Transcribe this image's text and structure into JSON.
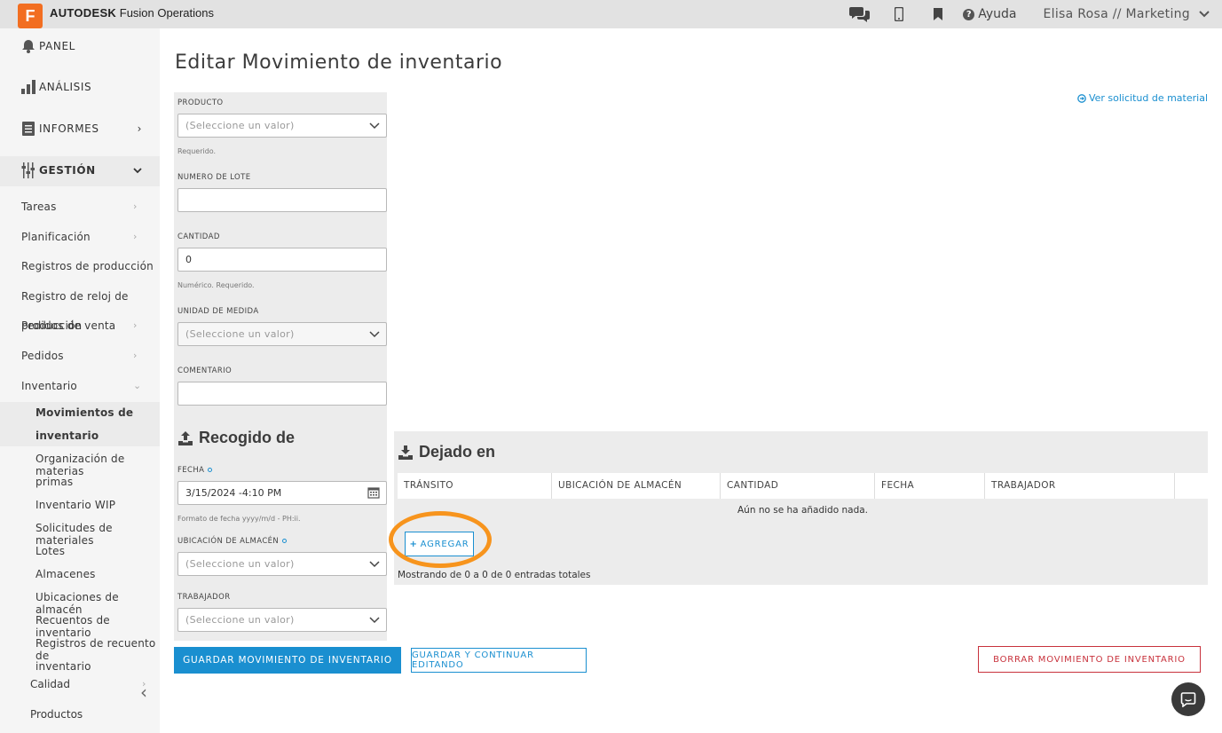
{
  "app": {
    "logo_letter": "F",
    "brand_strong": "AUTODESK",
    "brand_rest": "Fusion Operations",
    "accent_color": "#f26e21"
  },
  "header": {
    "icons": [
      "chat-icon",
      "mobile-icon",
      "bookmark-icon"
    ],
    "help_label": "Ayuda",
    "user_label": "Elisa Rosa // Marketing"
  },
  "sidebar": {
    "panel": "PANEL",
    "analisis": "ANÁLISIS",
    "informes": "INFORMES",
    "gestion": "GESTIÓN",
    "items": [
      {
        "label": "Tareas"
      },
      {
        "label": "Planificación"
      },
      {
        "label": "Registros de producción"
      },
      {
        "label": "Registro de reloj de"
      },
      {
        "label": "Pedidos de venta"
      },
      {
        "label": "Pedidos"
      },
      {
        "label": "Inventario"
      }
    ],
    "overlap_text": "producción",
    "sub_items": [
      {
        "label": "Movimientos de"
      },
      {
        "label": "inventario"
      },
      {
        "label": "Organización de materias"
      },
      {
        "label": "primas"
      },
      {
        "label": "Inventario WIP"
      },
      {
        "label": "Solicitudes de materiales"
      },
      {
        "label": "Lotes"
      },
      {
        "label": "Almacenes"
      },
      {
        "label": "Ubicaciones de almacén"
      },
      {
        "label": "Recuentos de inventario"
      },
      {
        "label": "Registros de recuento de"
      },
      {
        "label": "inventario"
      }
    ],
    "calidad": "Calidad",
    "productos": "Productos"
  },
  "page": {
    "title": "Editar Movimiento de inventario",
    "ver_solicitud": "Ver solicitud de material"
  },
  "form": {
    "producto_label": "PRODUCTO",
    "producto_placeholder": "(Seleccione un valor)",
    "producto_hint": "Requerido.",
    "lote_label": "NUMERO DE LOTE",
    "lote_value": "",
    "cantidad_label": "CANTIDAD",
    "cantidad_value": "0",
    "cantidad_hint": "Numérico. Requerido.",
    "unidad_label": "UNIDAD DE MEDIDA",
    "unidad_placeholder": "(Seleccione un valor)",
    "comentario_label": "COMENTARIO",
    "comentario_value": ""
  },
  "recogido": {
    "title": "Recogido de",
    "fecha_label": "FECHA",
    "fecha_value": "3/15/2024 -4:10 PM",
    "fecha_hint": "Formato de fecha yyyy/m/d - PH:ii.",
    "ubicacion_label": "UBICACIÓN DE ALMACÉN",
    "ubicacion_placeholder": "(Seleccione un valor)",
    "trabajador_label": "TRABAJADOR",
    "trabajador_placeholder": "(Seleccione un valor)"
  },
  "dejado": {
    "title": "Dejado en",
    "columns": [
      "TRÁNSITO",
      "UBICACIÓN DE ALMACÉN",
      "CANTIDAD",
      "FECHA",
      "TRABAJADOR"
    ],
    "empty_text": "Aún no se ha añadido nada.",
    "add_label": "AGREGAR",
    "showing_text": "Mostrando de 0 a 0 de 0 entradas totales"
  },
  "actions": {
    "save": "GUARDAR MOVIMIENTO DE INVENTARIO",
    "save_continue": "GUARDAR Y CONTINUAR EDITANDO",
    "delete": "BORRAR MOVIMIENTO DE INVENTARIO"
  },
  "colors": {
    "primary": "#1a8fd0",
    "danger": "#c8323c",
    "highlight": "#f7941d"
  }
}
